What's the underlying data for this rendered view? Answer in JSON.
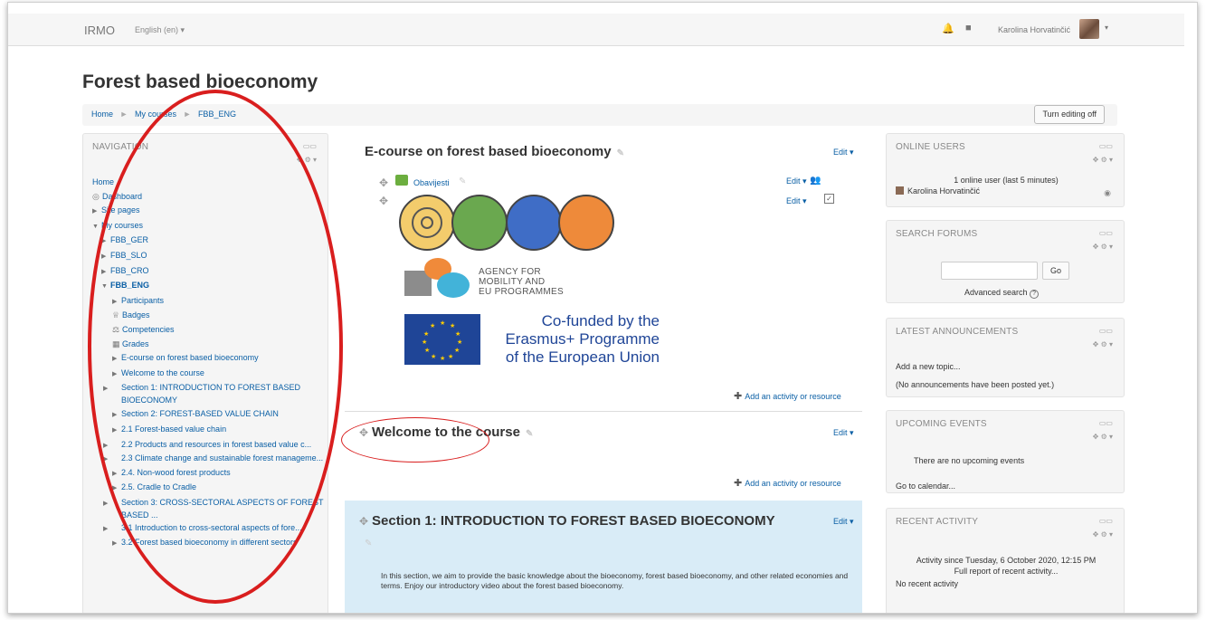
{
  "header": {
    "brand": "IRMO",
    "language": "English (en) ▾",
    "user_name": "Karolina Horvatinčić",
    "user_caret": "▾"
  },
  "page": {
    "title": "Forest based bioeconomy",
    "breadcrumb": [
      "Home",
      "My courses",
      "FBB_ENG"
    ],
    "edit_toggle": "Turn editing off"
  },
  "navigation": {
    "title": "NAVIGATION",
    "items": [
      {
        "label": "Home",
        "level": 1,
        "arrow": "",
        "icon": ""
      },
      {
        "label": "Dashboard",
        "level": 1,
        "arrow": "",
        "icon": "◎"
      },
      {
        "label": "Site pages",
        "level": 1,
        "arrow": "▶",
        "icon": ""
      },
      {
        "label": "My courses",
        "level": 1,
        "arrow": "▼",
        "icon": ""
      },
      {
        "label": "FBB_GER",
        "level": 3,
        "arrow": "▶",
        "icon": ""
      },
      {
        "label": "FBB_SLO",
        "level": 3,
        "arrow": "▶",
        "icon": ""
      },
      {
        "label": "FBB_CRO",
        "level": 3,
        "arrow": "▶",
        "icon": ""
      },
      {
        "label": "FBB_ENG",
        "level": 3,
        "arrow": "▼",
        "icon": "",
        "bold": true
      },
      {
        "label": "Participants",
        "level": 4,
        "arrow": "▶",
        "icon": ""
      },
      {
        "label": "Badges",
        "level": 4,
        "arrow": "",
        "icon": "♕"
      },
      {
        "label": "Competencies",
        "level": 4,
        "arrow": "",
        "icon": "⚖"
      },
      {
        "label": "Grades",
        "level": 4,
        "arrow": "",
        "icon": "▦"
      },
      {
        "label": "E-course on forest based bioeconomy",
        "level": 4,
        "arrow": "▶",
        "icon": ""
      },
      {
        "label": "Welcome to the course",
        "level": 4,
        "arrow": "▶",
        "icon": ""
      },
      {
        "label": "Section 1: INTRODUCTION TO FOREST BASED BIOECONOMY",
        "level": 5,
        "arrow": "▶",
        "icon": ""
      },
      {
        "label": "Section 2: FOREST-BASED VALUE CHAIN",
        "level": 4,
        "arrow": "▶",
        "icon": ""
      },
      {
        "label": "2.1 Forest-based value chain",
        "level": 4,
        "arrow": "▶",
        "icon": ""
      },
      {
        "label": "2.2 Products and resources in forest based value c...",
        "level": 5,
        "arrow": "▶",
        "icon": ""
      },
      {
        "label": "2.3 Climate change and sustainable forest manageme...",
        "level": 5,
        "arrow": "▶",
        "icon": ""
      },
      {
        "label": "2.4. Non-wood forest products",
        "level": 4,
        "arrow": "▶",
        "icon": ""
      },
      {
        "label": "2.5. Cradle to Cradle",
        "level": 4,
        "arrow": "▶",
        "icon": ""
      },
      {
        "label": "Section 3: CROSS-SECTORAL ASPECTS OF FOREST BASED ...",
        "level": 5,
        "arrow": "▶",
        "icon": ""
      },
      {
        "label": "3.1 Introduction to cross-sectoral aspects of fore...",
        "level": 5,
        "arrow": "▶",
        "icon": ""
      },
      {
        "label": "3.2 Forest based bioeconomy in different sectors",
        "level": 4,
        "arrow": "▶",
        "icon": ""
      }
    ]
  },
  "main": {
    "section0": {
      "title": "E-course on forest based bioeconomy",
      "edit": "Edit ▾",
      "activity_name": "Obavijesti",
      "activity_edit": "Edit ▾",
      "label_edit": "Edit ▾",
      "agency_text": [
        "AGENCY FOR",
        "MOBILITY AND",
        "EU PROGRAMMES"
      ],
      "erasmus_text": [
        "Co-funded by the",
        "Erasmus+ Programme",
        "of the European Union"
      ],
      "add_activity": "Add an activity or resource"
    },
    "section1": {
      "title": "Welcome to the course",
      "edit": "Edit ▾",
      "add_activity": "Add an activity or resource"
    },
    "section2": {
      "title": "Section 1: INTRODUCTION TO FOREST BASED BIOECONOMY",
      "edit": "Edit ▾",
      "summary": "In this section, we aim to provide the basic knowledge about the bioeconomy, forest based bioeconomy, and other related economies and terms. Enjoy our introductory video about the forest based bioeconomy."
    }
  },
  "blocks": {
    "online_users": {
      "title": "ONLINE USERS",
      "summary": "1 online user (last 5 minutes)",
      "user": "Karolina Horvatinčić"
    },
    "search_forums": {
      "title": "SEARCH FORUMS",
      "go": "Go",
      "advanced": "Advanced search"
    },
    "latest_announcements": {
      "title": "LATEST ANNOUNCEMENTS",
      "add_topic": "Add a new topic...",
      "empty": "(No announcements have been posted yet.)"
    },
    "upcoming_events": {
      "title": "UPCOMING EVENTS",
      "empty": "There are no upcoming events",
      "calendar": "Go to calendar..."
    },
    "recent_activity": {
      "title": "RECENT ACTIVITY",
      "since": "Activity since Tuesday, 6 October 2020, 12:15 PM",
      "report": "Full report of recent activity...",
      "empty": "No recent activity"
    }
  },
  "colors": {
    "link": "#0a5fa5",
    "annotation": "#d91e1e",
    "highlight_section": "#d9ecf7",
    "eu_blue": "#1f4597"
  }
}
